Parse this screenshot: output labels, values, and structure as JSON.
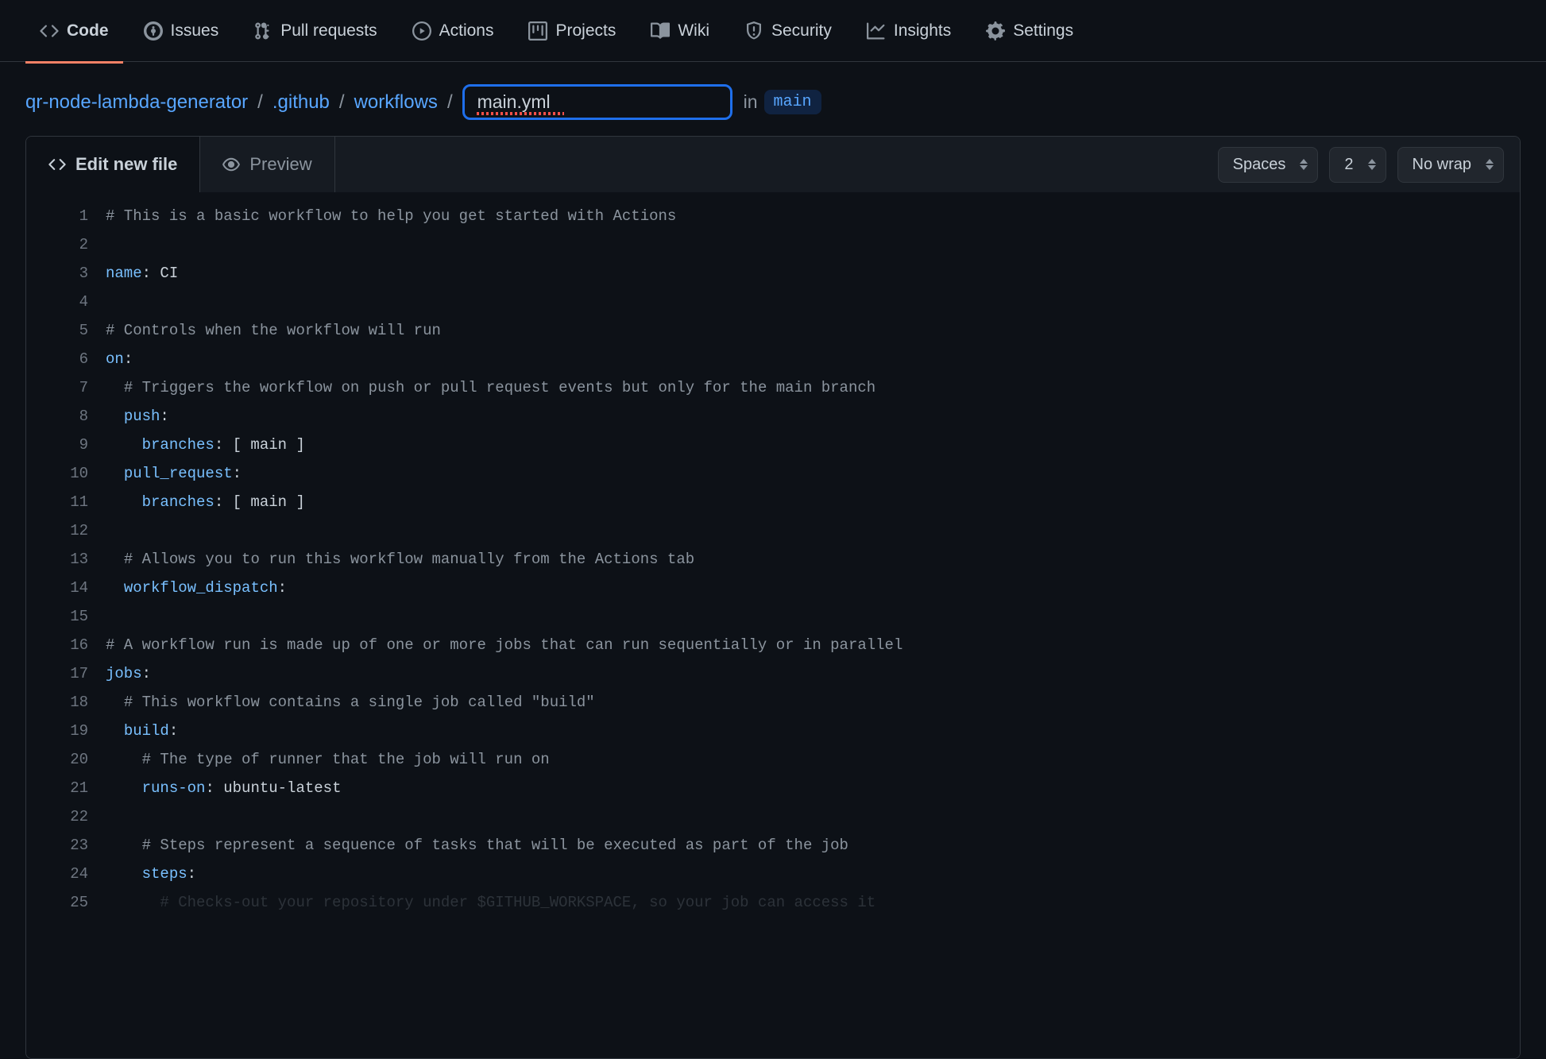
{
  "nav": {
    "items": [
      {
        "id": "code",
        "label": "Code"
      },
      {
        "id": "issues",
        "label": "Issues"
      },
      {
        "id": "pull-requests",
        "label": "Pull requests"
      },
      {
        "id": "actions",
        "label": "Actions"
      },
      {
        "id": "projects",
        "label": "Projects"
      },
      {
        "id": "wiki",
        "label": "Wiki"
      },
      {
        "id": "security",
        "label": "Security"
      },
      {
        "id": "insights",
        "label": "Insights"
      },
      {
        "id": "settings",
        "label": "Settings"
      }
    ],
    "selected": "code"
  },
  "breadcrumb": {
    "repo": "qr-node-lambda-generator",
    "parts": [
      ".github",
      "workflows"
    ],
    "filename": "main.yml",
    "in_label": "in",
    "branch": "main"
  },
  "editor": {
    "tabs": {
      "edit": "Edit new file",
      "preview": "Preview",
      "active": "edit"
    },
    "indent_style": "Spaces",
    "indent_size": "2",
    "wrap": "No wrap"
  },
  "code": [
    {
      "type": "comment",
      "text": "# This is a basic workflow to help you get started with Actions"
    },
    {
      "type": "blank",
      "text": ""
    },
    {
      "type": "kv",
      "key": "name",
      "post": ": CI"
    },
    {
      "type": "blank",
      "text": ""
    },
    {
      "type": "comment",
      "text": "# Controls when the workflow will run"
    },
    {
      "type": "kv",
      "key": "on",
      "post": ":"
    },
    {
      "type": "comment",
      "indent": "  ",
      "text": "# Triggers the workflow on push or pull request events but only for the main branch"
    },
    {
      "type": "kv",
      "indent": "  ",
      "key": "push",
      "post": ":"
    },
    {
      "type": "kv",
      "indent": "    ",
      "key": "branches",
      "post": ": [ main ]"
    },
    {
      "type": "kv",
      "indent": "  ",
      "key": "pull_request",
      "post": ":"
    },
    {
      "type": "kv",
      "indent": "    ",
      "key": "branches",
      "post": ": [ main ]"
    },
    {
      "type": "blank",
      "text": ""
    },
    {
      "type": "comment",
      "indent": "  ",
      "text": "# Allows you to run this workflow manually from the Actions tab"
    },
    {
      "type": "kv",
      "indent": "  ",
      "key": "workflow_dispatch",
      "post": ":"
    },
    {
      "type": "blank",
      "text": ""
    },
    {
      "type": "comment",
      "text": "# A workflow run is made up of one or more jobs that can run sequentially or in parallel"
    },
    {
      "type": "kv",
      "key": "jobs",
      "post": ":"
    },
    {
      "type": "comment",
      "indent": "  ",
      "text": "# This workflow contains a single job called \"build\""
    },
    {
      "type": "kv",
      "indent": "  ",
      "key": "build",
      "post": ":"
    },
    {
      "type": "comment",
      "indent": "    ",
      "text": "# The type of runner that the job will run on"
    },
    {
      "type": "kv",
      "indent": "    ",
      "key": "runs-on",
      "post": ": ubuntu-latest"
    },
    {
      "type": "blank",
      "text": ""
    },
    {
      "type": "comment",
      "indent": "    ",
      "text": "# Steps represent a sequence of tasks that will be executed as part of the job"
    },
    {
      "type": "kv",
      "indent": "    ",
      "key": "steps",
      "post": ":"
    },
    {
      "type": "comment",
      "indent": "      ",
      "text": "# Checks-out your repository under $GITHUB_WORKSPACE, so your job can access it",
      "fade": true
    }
  ]
}
